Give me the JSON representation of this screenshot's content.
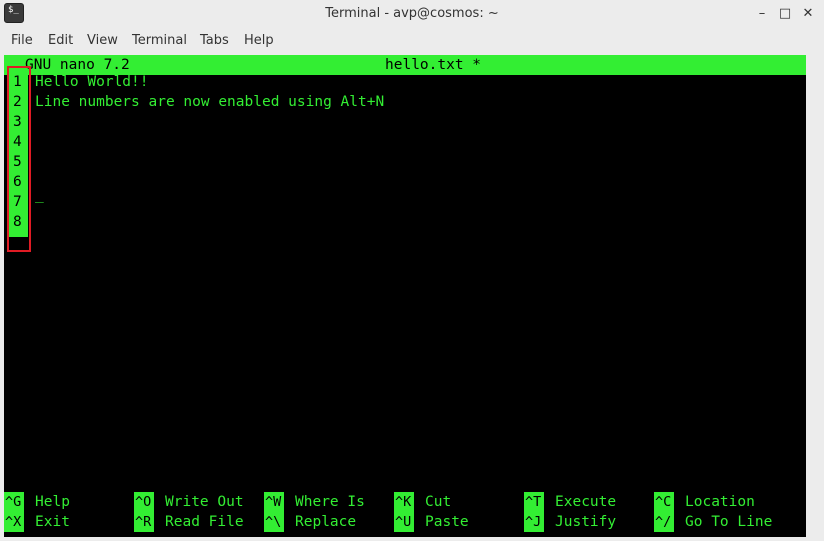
{
  "window": {
    "icon_text": "$_",
    "title": "Terminal - avp@cosmos: ~",
    "minimize_glyph": "–",
    "maximize_glyph": "□",
    "close_glyph": "✕"
  },
  "menu": [
    "File",
    "Edit",
    "View",
    "Terminal",
    "Tabs",
    "Help"
  ],
  "nano": {
    "version_label": "GNU nano 7.2",
    "filename_label": "hello.txt *",
    "line_numbers": [
      "1",
      "2",
      "3",
      "4",
      "5",
      "6",
      "7",
      "8"
    ],
    "lines": [
      "Hello World!!",
      "Line numbers are now enabled using Alt+N"
    ],
    "cursor_glyph": "_",
    "shortcuts": [
      {
        "key": "^G",
        "label": "Help"
      },
      {
        "key": "^X",
        "label": "Exit"
      },
      {
        "key": "^O",
        "label": "Write Out"
      },
      {
        "key": "^R",
        "label": "Read File"
      },
      {
        "key": "^W",
        "label": "Where Is"
      },
      {
        "key": "^\\",
        "label": "Replace"
      },
      {
        "key": "^K",
        "label": "Cut"
      },
      {
        "key": "^U",
        "label": "Paste"
      },
      {
        "key": "^T",
        "label": "Execute"
      },
      {
        "key": "^J",
        "label": "Justify"
      },
      {
        "key": "^C",
        "label": "Location"
      },
      {
        "key": "^/",
        "label": "Go To Line"
      }
    ]
  },
  "colors": {
    "terminal_bg": "#000000",
    "nano_green": "#33ee33",
    "annotation_red": "#e01b24"
  }
}
